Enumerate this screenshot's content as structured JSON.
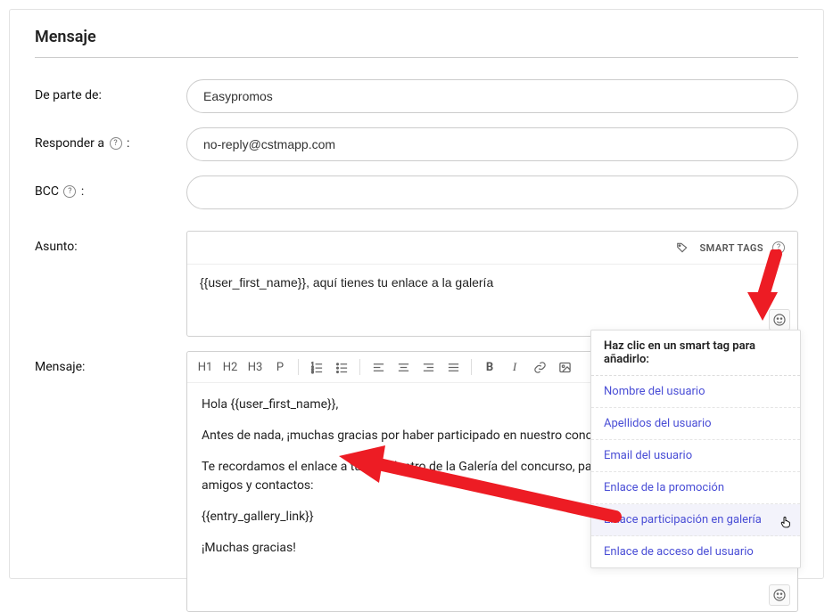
{
  "panel": {
    "title": "Mensaje"
  },
  "labels": {
    "from": "De parte de:",
    "reply_to": "Responder a",
    "bcc": "BCC",
    "subject": "Asunto:",
    "message": "Mensaje:"
  },
  "from_value": "Easypromos",
  "reply_to_value": "no-reply@cstmapp.com",
  "bcc_value": "",
  "smart_tags_label": "SMART TAGS",
  "subject_value": "{{user_first_name}}, aquí tienes tu enlace a la galería",
  "toolbar": {
    "h1": "H1",
    "h2": "H2",
    "h3": "H3",
    "p": "P",
    "bold": "B",
    "italic": "I"
  },
  "message_body": {
    "p1": "Hola {{user_first_name}},",
    "p2": "Antes de nada, ¡muchas gracias por haber participado en nuestro concurso!",
    "p3": "Te recordamos el enlace a tu foto dentro de la Galería del concurso, para que puedas compartir con tus amigos y contactos:",
    "p4": "{{entry_gallery_link}}",
    "p5": "¡Muchas gracias!"
  },
  "popover": {
    "title": "Haz clic en un smart tag para añadirlo:",
    "items": [
      "Nombre del usuario",
      "Apellidos del usuario",
      "Email del usuario",
      "Enlace de la promoción",
      "Enlace participación en galería",
      "Enlace de acceso del usuario"
    ]
  },
  "icons": {
    "help": "?",
    "close": "✕",
    "emoji": "☺",
    "colon": ":"
  }
}
